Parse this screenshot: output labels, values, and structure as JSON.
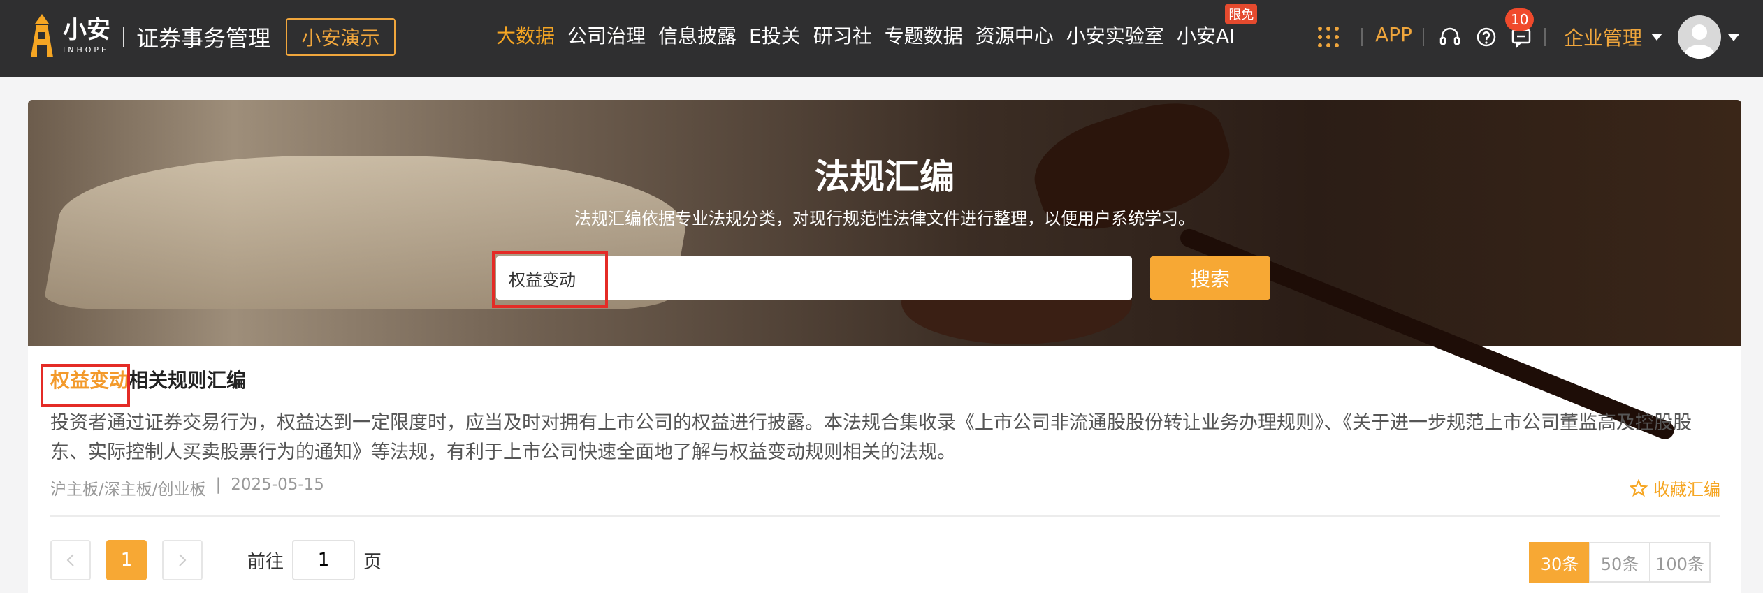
{
  "header": {
    "logo_cn": "小安",
    "logo_en": "INHOPE",
    "app_name": "证券事务管理",
    "demo_button": "小安演示",
    "nav": [
      {
        "label": "大数据",
        "active": true
      },
      {
        "label": "公司治理"
      },
      {
        "label": "信息披露"
      },
      {
        "label": "E投关"
      },
      {
        "label": "研习社"
      },
      {
        "label": "专题数据"
      },
      {
        "label": "资源中心"
      },
      {
        "label": "小安实验室"
      },
      {
        "label": "小安AI",
        "badge": "限免"
      }
    ],
    "app_link": "APP",
    "message_count": "10",
    "org_menu": "企业管理"
  },
  "banner": {
    "title": "法规汇编",
    "subtitle": "法规汇编依据专业法规分类，对现行规范性法律文件进行整理，以便用户系统学习。",
    "search_value": "权益变动",
    "search_button": "搜索"
  },
  "result": {
    "title_keyword": "权益变动",
    "title_rest": "相关规则汇编",
    "description": "投资者通过证券交易行为，权益达到一定限度时，应当及时对拥有上市公司的权益进行披露。本法规合集收录《上市公司非流通股股份转让业务办理规则》、《关于进一步规范上市公司董监高及控股股东、实际控制人买卖股票行为的通知》等法规，有利于上市公司快速全面地了解与权益变动规则相关的法规。",
    "boards": "沪主板/深主板/创业板",
    "separator": "|",
    "date": "2025-05-15",
    "favorite": "收藏汇编"
  },
  "pagination": {
    "current_page": "1",
    "goto_prefix": "前往",
    "goto_value": "1",
    "goto_suffix": "页",
    "page_sizes": [
      {
        "label": "30条",
        "active": true
      },
      {
        "label": "50条"
      },
      {
        "label": "100条"
      }
    ]
  },
  "colors": {
    "accent": "#f7a834",
    "highlight_box": "#e42b26",
    "topbar": "#2f2f30"
  }
}
